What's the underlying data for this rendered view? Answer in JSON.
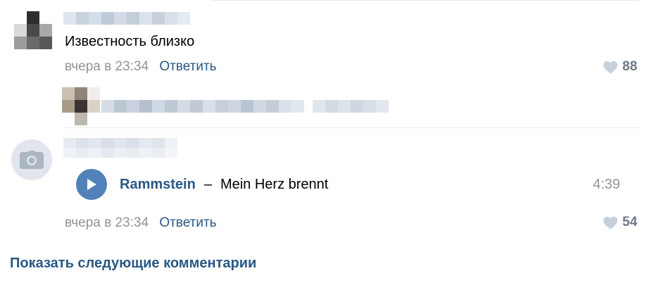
{
  "comments": [
    {
      "text": "Известность близко",
      "date": "вчера в 23:34",
      "reply_label": "Ответить",
      "likes": "88"
    },
    {
      "audio": {
        "artist": "Rammstein",
        "dash": "–",
        "title": "Mein Herz brennt",
        "duration": "4:39"
      },
      "date": "вчера в 23:34",
      "reply_label": "Ответить",
      "likes": "54"
    }
  ],
  "show_more_label": "Показать следующие комментарии",
  "icons": {
    "heart": "heart-icon",
    "play": "play-icon",
    "camera": "camera-icon"
  },
  "colors": {
    "link": "#2a5885",
    "meta": "#939393",
    "play_button": "#5181b8",
    "avatar_placeholder": "#e1e5ec",
    "like_count": "#6d7885"
  }
}
